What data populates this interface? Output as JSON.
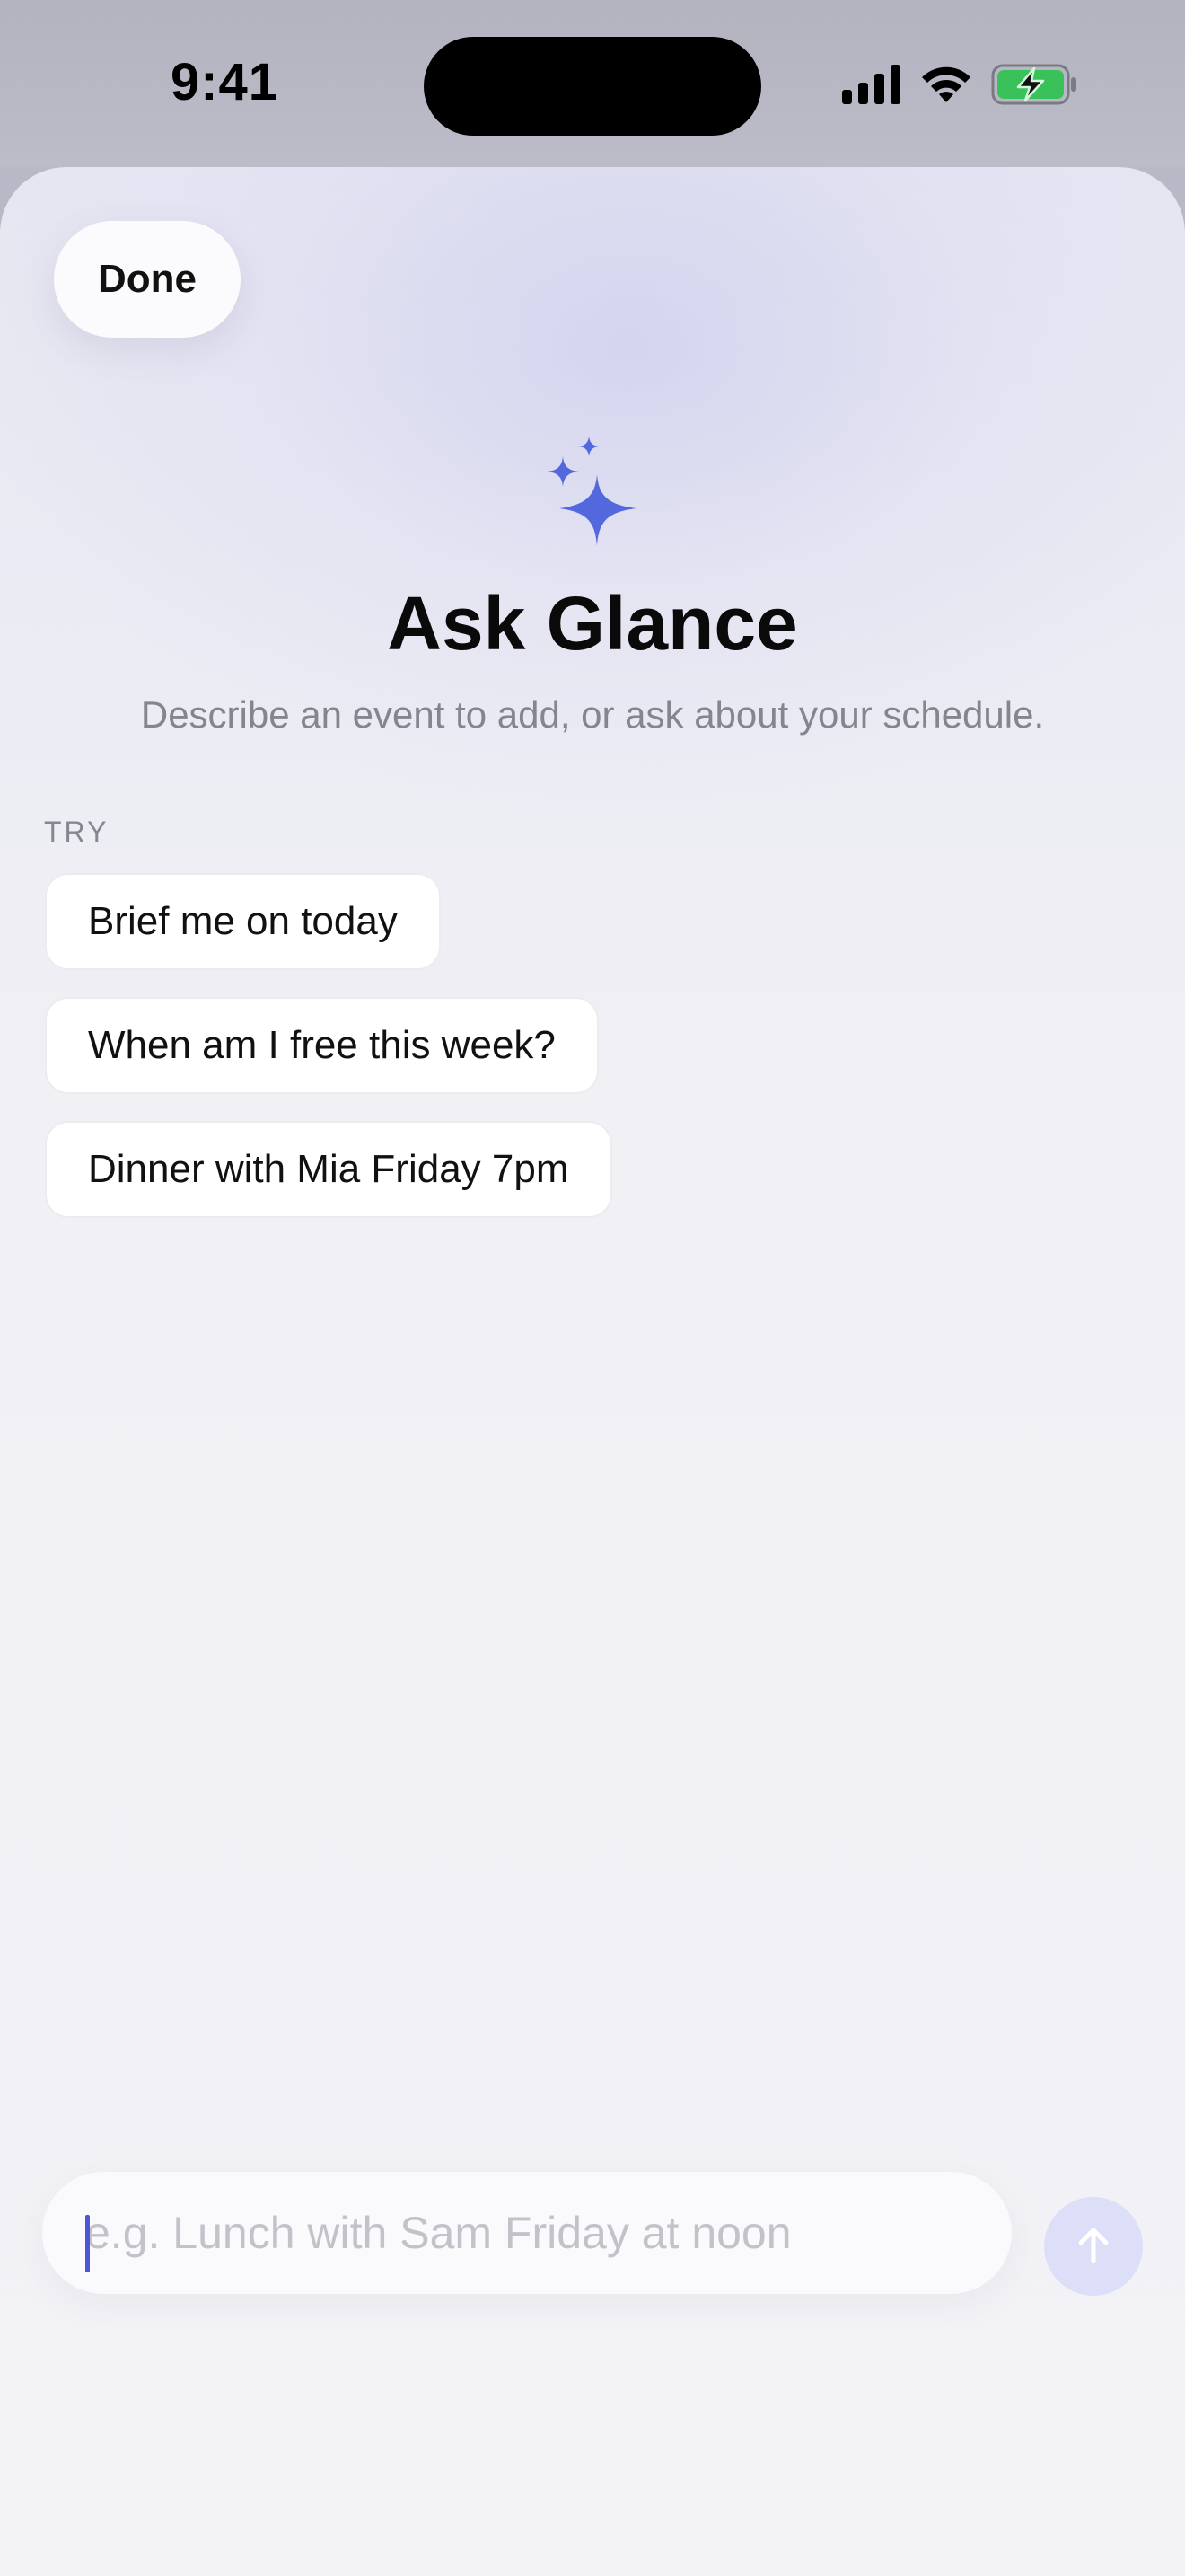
{
  "status_bar": {
    "time": "9:41",
    "icons": [
      "cellular-signal-icon",
      "wifi-icon",
      "battery-charging-icon"
    ]
  },
  "sheet": {
    "done_label": "Done",
    "icon": "sparkles-icon",
    "title": "Ask Glance",
    "subtitle": "Describe an event to add, or ask about your schedule.",
    "try_label": "TRY",
    "suggestions": [
      "Brief me on today",
      "When am I free this week?",
      "Dinner with Mia Friday 7pm"
    ]
  },
  "composer": {
    "value": "",
    "placeholder": "e.g. Lunch with Sam Friday at noon",
    "send_icon": "arrow-up-icon"
  },
  "colors": {
    "accent": "#5468de",
    "send_button_bg": "#dcdff7",
    "battery_green": "#3ac25a"
  }
}
